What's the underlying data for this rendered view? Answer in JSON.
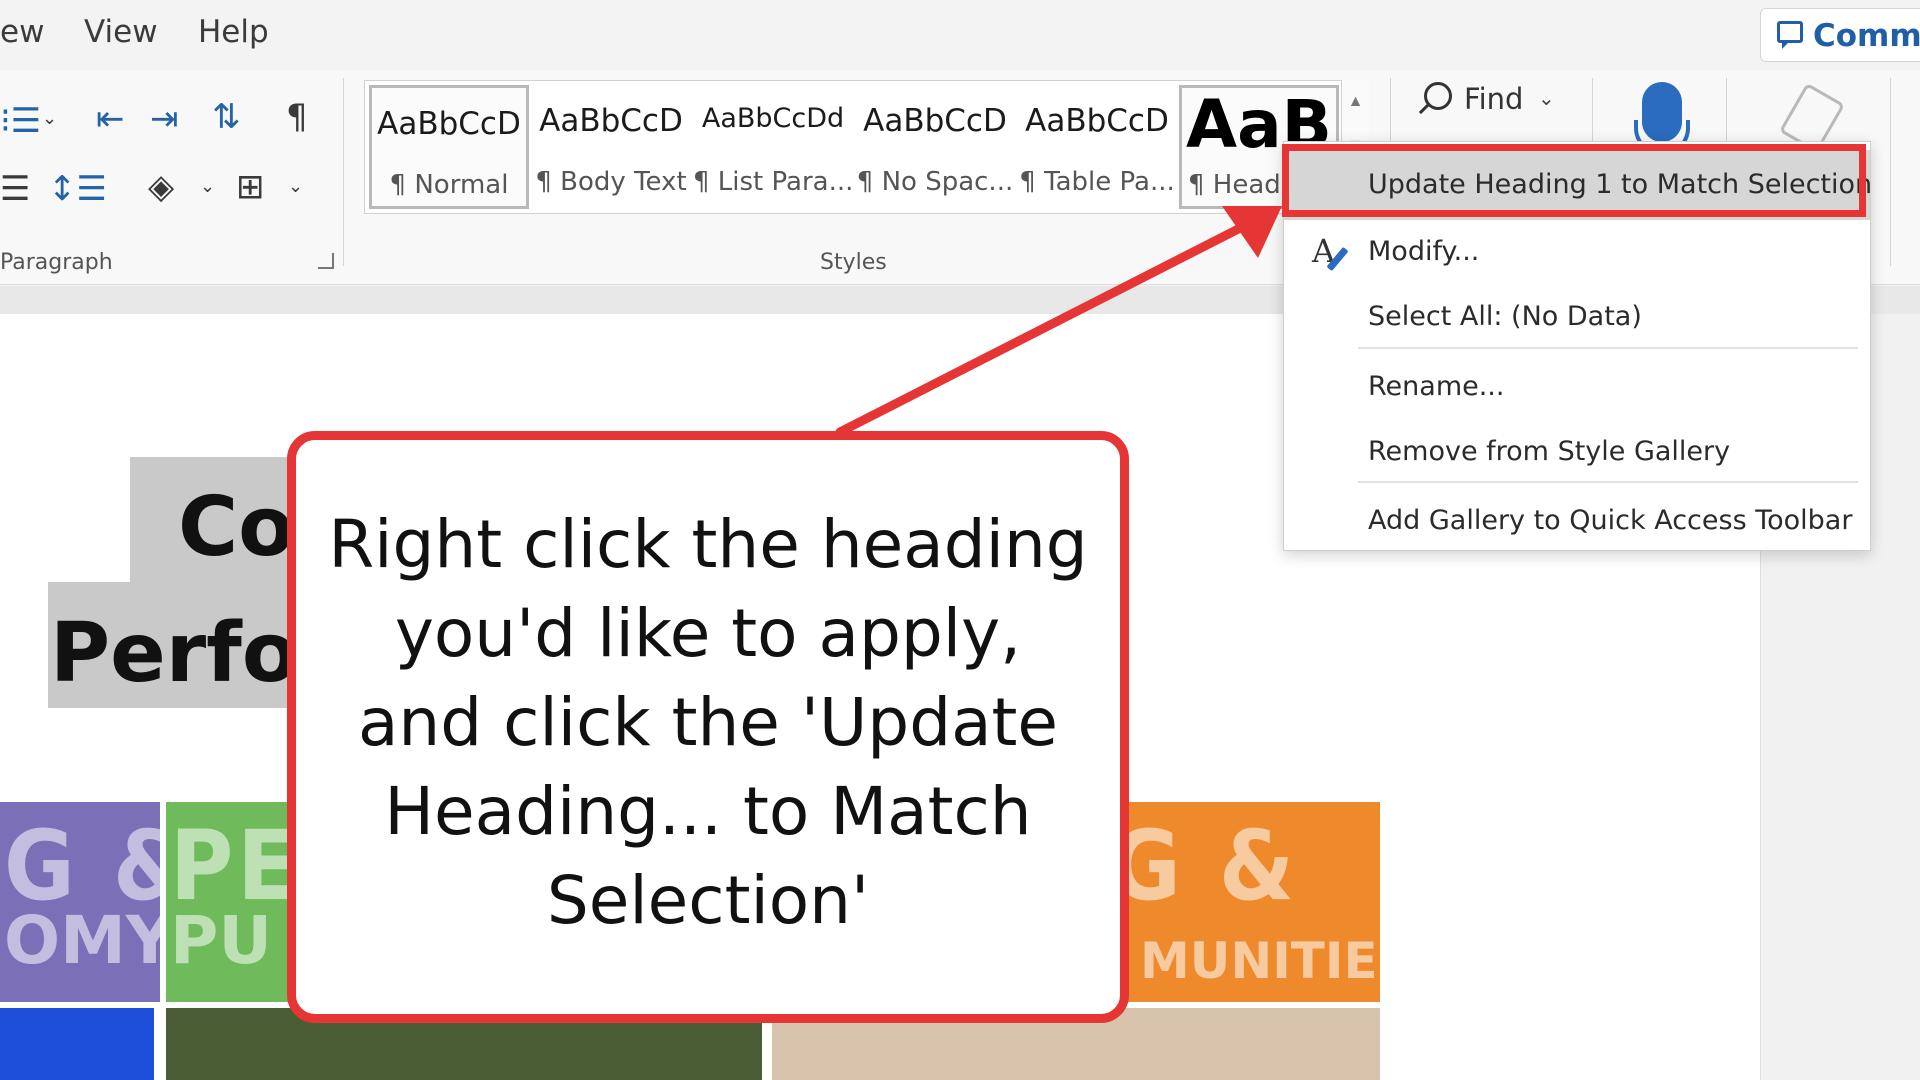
{
  "menu": {
    "items": [
      "ew",
      "View",
      "Help"
    ],
    "comments_label": "Comme"
  },
  "ribbon": {
    "paragraph_label": "Paragraph",
    "styles_label": "Styles",
    "find_label": "Find",
    "styles": [
      {
        "sample": "AaBbCcD",
        "name": "¶ Normal"
      },
      {
        "sample": "AaBbCcD",
        "name": "¶ Body Text"
      },
      {
        "sample": "AaBbCcDd",
        "name": "¶ List Para..."
      },
      {
        "sample": "AaBbCcD",
        "name": "¶ No Spac..."
      },
      {
        "sample": "AaBbCcD",
        "name": "¶ Table Pa..."
      },
      {
        "sample": "AaB",
        "name": "¶ Headi"
      }
    ]
  },
  "document": {
    "heading_line1": "Co",
    "heading_line2": "Perfor",
    "tiles": [
      {
        "t1": "G &",
        "t2": "OMY",
        "color": "#7b6fb8"
      },
      {
        "t1": "PE",
        "t2": "PU",
        "color": "#6fba5b"
      },
      {
        "t1": "G &",
        "t2": "MUNITIES",
        "color": "#ef8a2c"
      }
    ]
  },
  "context_menu": {
    "items": [
      {
        "label": "Update Heading 1 to Match Selection"
      },
      {
        "label": "Modify..."
      },
      {
        "label": "Select All: (No Data)"
      },
      {
        "label": "Rename..."
      },
      {
        "label": "Remove from Style Gallery"
      },
      {
        "label": "Add Gallery to Quick Access Toolbar"
      }
    ]
  },
  "callout": {
    "text": "Right click the heading you'd like to apply, and click the 'Update Heading... to Match Selection'"
  },
  "colors": {
    "annotation_red": "#e53535",
    "accent_blue": "#2b6cbf"
  }
}
